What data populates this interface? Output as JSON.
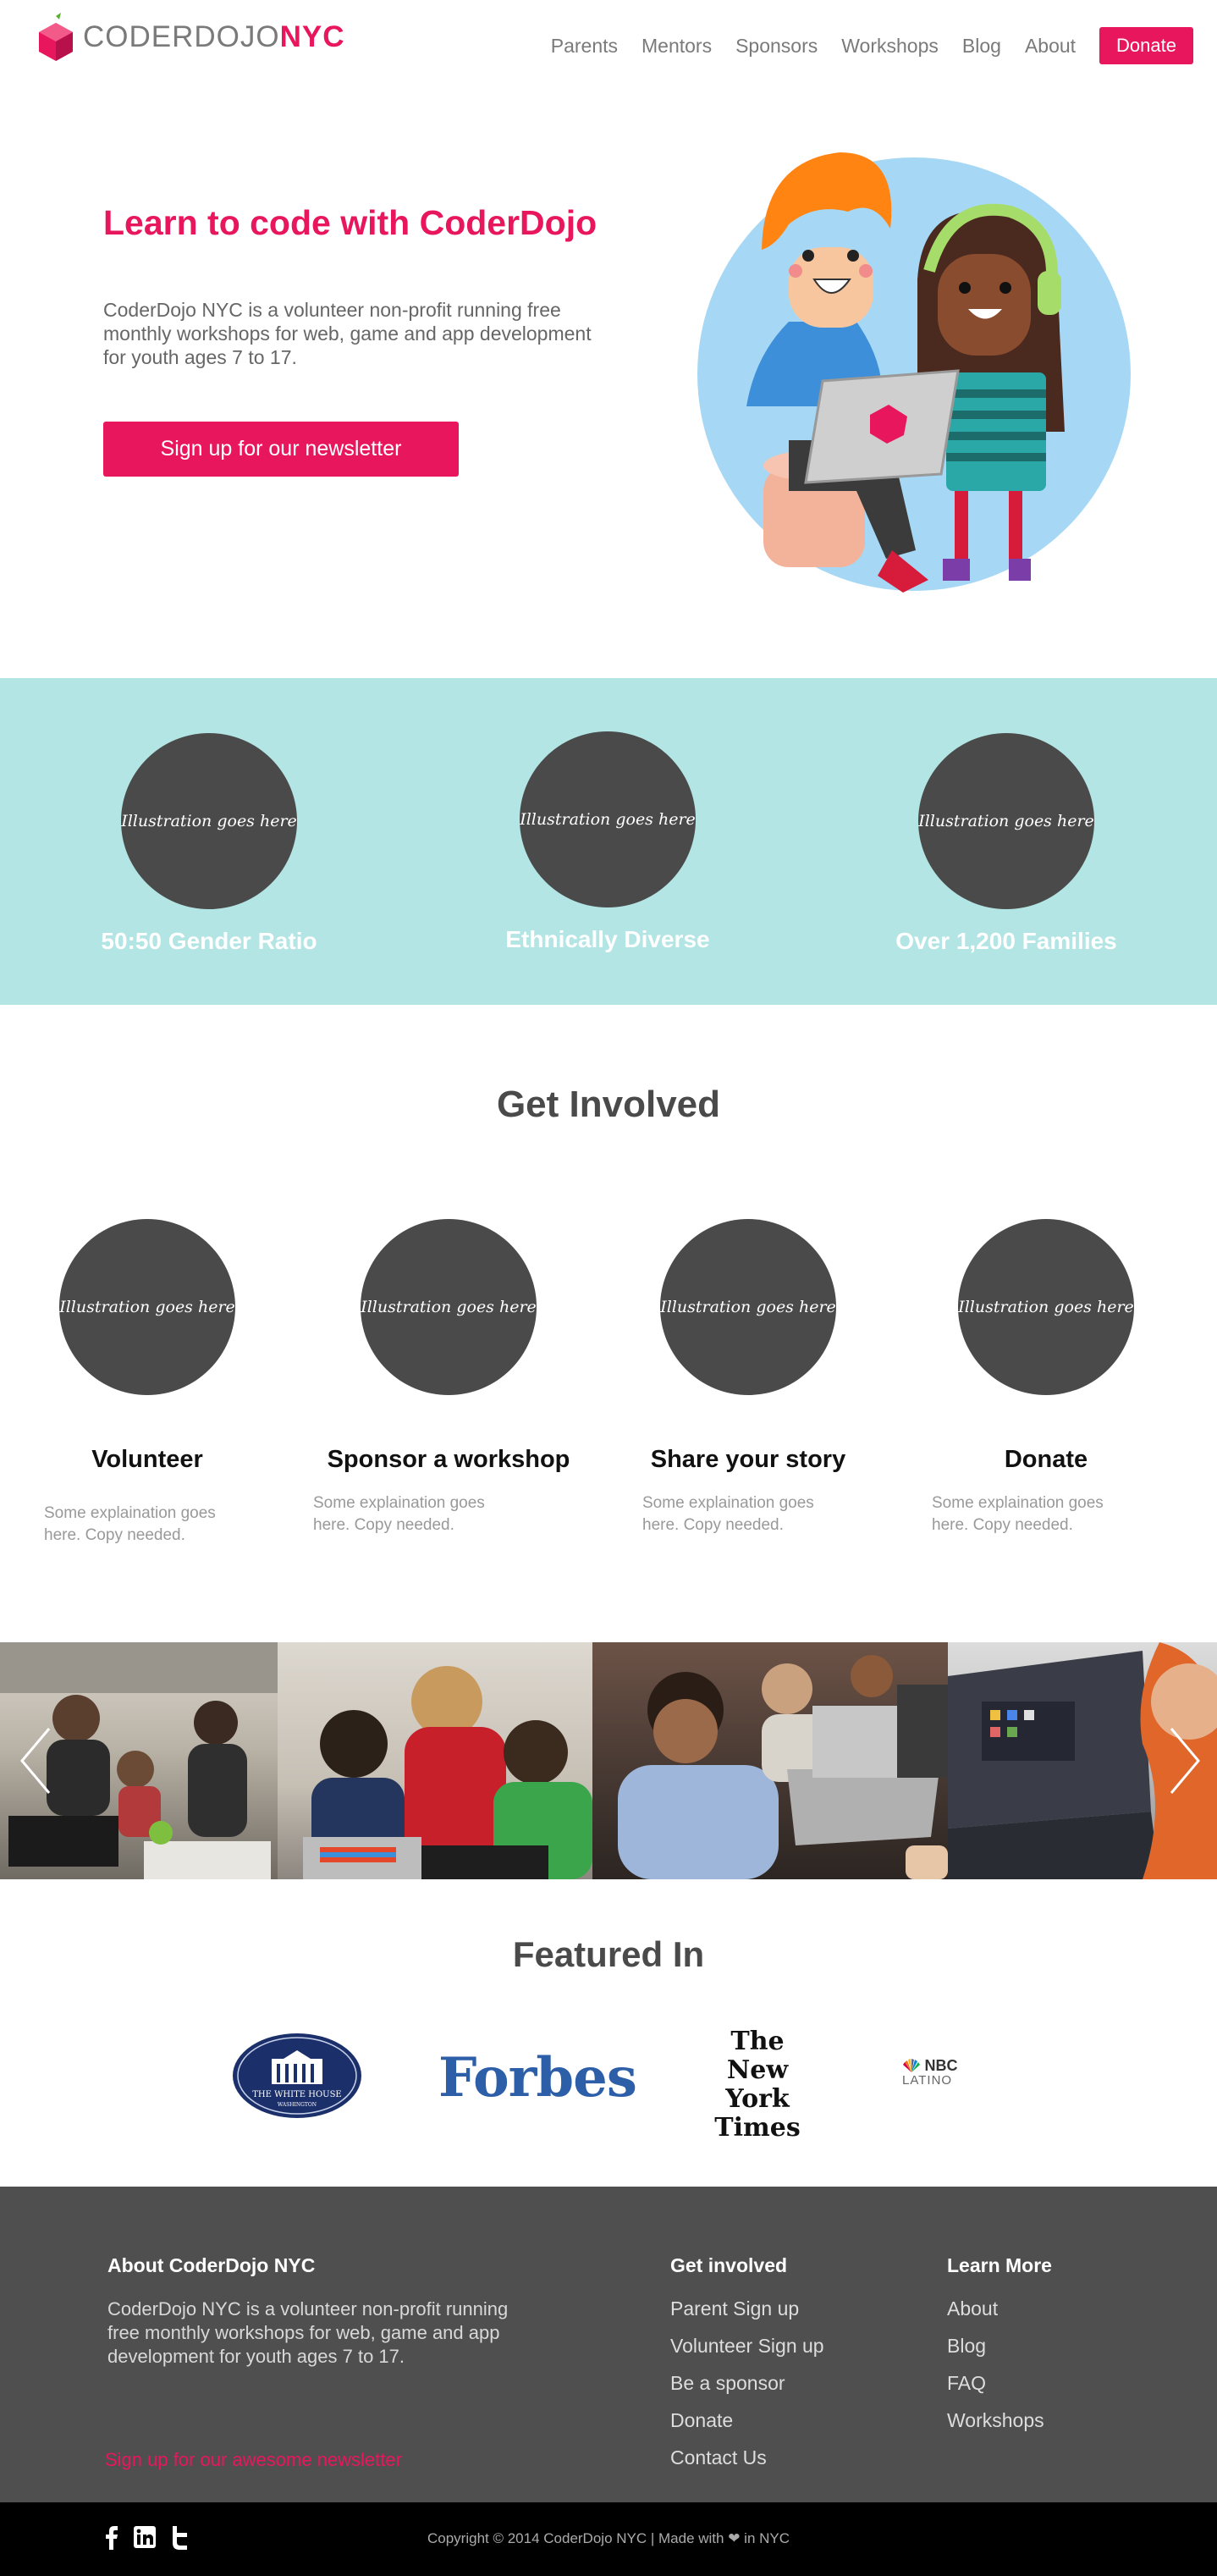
{
  "header": {
    "logo_light": "CODERDOJO",
    "logo_bold": "NYC",
    "nav": [
      "Parents",
      "Mentors",
      "Sponsors",
      "Workshops",
      "Blog",
      "About"
    ],
    "donate_label": "Donate"
  },
  "hero": {
    "title": "Learn to code with CoderDojo",
    "text": "CoderDojo NYC is a volunteer non-profit running free monthly workshops for web, game and app development for youth ages 7 to 17.",
    "button": "Sign up for our newsletter"
  },
  "stats": {
    "placeholder": "Illustration goes here",
    "items": [
      "50:50 Gender Ratio",
      "Ethnically Diverse",
      "Over 1,200 Families"
    ]
  },
  "get_involved": {
    "title": "Get Involved",
    "placeholder": "Illustration goes here",
    "cards": [
      {
        "name": "Volunteer",
        "desc": "Some explaination goes here. Copy needed."
      },
      {
        "name": "Sponsor a workshop",
        "desc": "Some explaination goes here. Copy needed."
      },
      {
        "name": "Share your story",
        "desc": "Some explaination goes here. Copy needed."
      },
      {
        "name": "Donate",
        "desc": "Some explaination goes here. Copy needed."
      }
    ]
  },
  "featured": {
    "title": "Featured In",
    "logos": {
      "whitehouse": "THE WHITE HOUSE",
      "whitehouse_sub": "WASHINGTON",
      "forbes": "Forbes",
      "nyt_1": "The",
      "nyt_2": "New York",
      "nyt_3": "Times",
      "nbc": "NBC",
      "nbc_sub": "LATINO"
    }
  },
  "footer": {
    "about_heading": "About CoderDojo NYC",
    "about_text": "CoderDojo NYC is a volunteer non-profit running free monthly workshops for web, game and app development for youth ages 7 to 17.",
    "newsletter": "Sign up for our awesome newsletter",
    "involved_heading": "Get involved",
    "involved_links": [
      "Parent Sign up",
      "Volunteer Sign up",
      "Be a sponsor",
      "Donate",
      "Contact Us"
    ],
    "learn_heading": "Learn More",
    "learn_links": [
      "About",
      "Blog",
      "FAQ",
      "Workshops"
    ],
    "copyright": "Copyright © 2014 CoderDojo NYC | Made with ❤ in NYC"
  },
  "colors": {
    "accent": "#e8175d",
    "band": "#b2e5e4",
    "dark_circle": "#4a4a4a",
    "footer": "#4f4f4f"
  }
}
